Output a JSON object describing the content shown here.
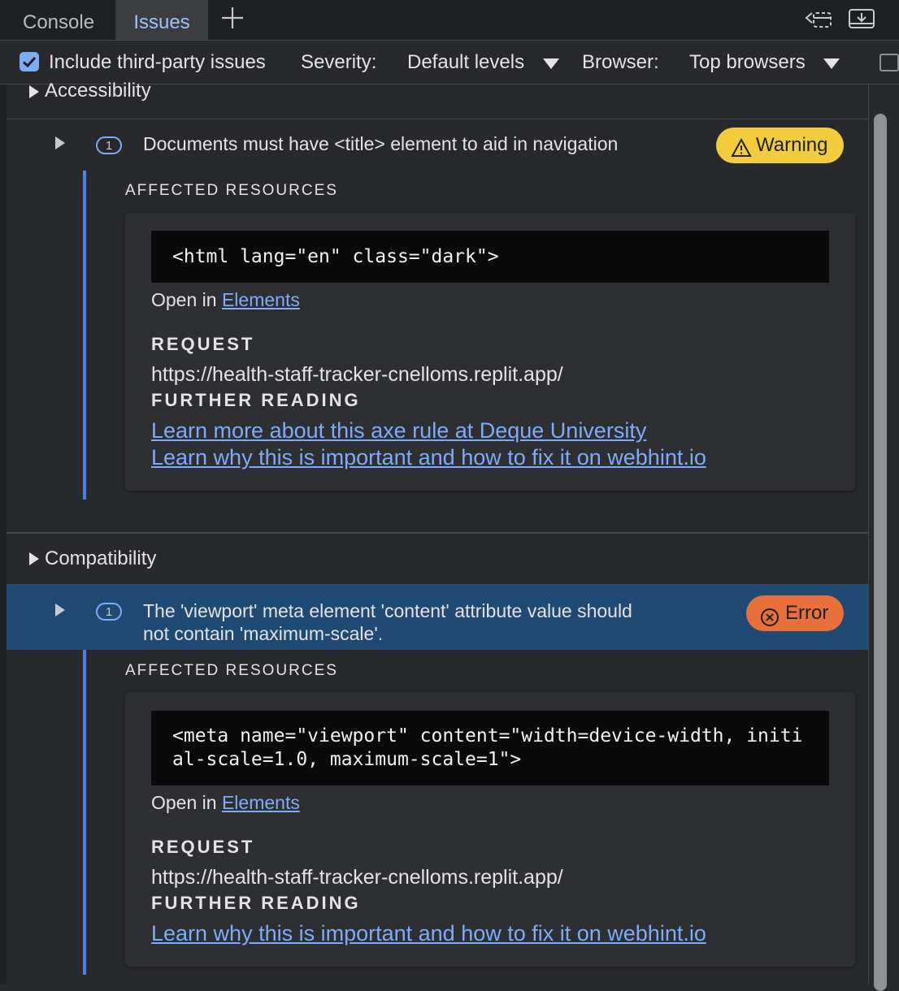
{
  "tabs": [
    {
      "label": "Console",
      "active": false
    },
    {
      "label": "Issues",
      "active": true
    }
  ],
  "toolbar": {
    "include_third_party_label": "Include third-party issues",
    "include_third_party_checked": true,
    "severity_label": "Severity:",
    "severity_value": "Default levels",
    "browser_label": "Browser:",
    "browser_value": "Top browsers"
  },
  "categories": [
    {
      "label": "Accessibility",
      "issue": {
        "count": "1",
        "title": "Documents must have <title> element to aid in navigation",
        "severity": "Warning",
        "affected_resources_label": "AFFECTED RESOURCES",
        "code": "<html lang=\"en\" class=\"dark\">",
        "open_in_prefix": "Open in",
        "open_in_link": "Elements",
        "request_label": "REQUEST",
        "request_url": "https://health-staff-tracker-cnelloms.replit.app/",
        "further_reading_label": "FURTHER READING",
        "links": [
          "Learn more about this axe rule at Deque University",
          "Learn why this is important and how to fix it on webhint.io"
        ]
      }
    },
    {
      "label": "Compatibility",
      "issue": {
        "count": "1",
        "title_line1": "The 'viewport' meta element 'content' attribute value should",
        "title_line2": "not contain 'maximum-scale'.",
        "severity": "Error",
        "affected_resources_label": "AFFECTED RESOURCES",
        "code": "<meta name=\"viewport\" content=\"width=device-width, initial-scale=1.0, maximum-scale=1\">",
        "open_in_prefix": "Open in",
        "open_in_link": "Elements",
        "request_label": "REQUEST",
        "request_url": "https://health-staff-tracker-cnelloms.replit.app/",
        "further_reading_label": "FURTHER READING",
        "links": [
          "Learn why this is important and how to fix it on webhint.io"
        ]
      }
    }
  ],
  "colors": {
    "accent": "#7cacf8",
    "warning": "#f2cc3d",
    "error": "#e8703a",
    "selected_row": "#1e4a73",
    "resource_bar": "#4a7fe3"
  },
  "icons": [
    "plus-icon",
    "dock-side-icon",
    "download-icon",
    "warning-icon",
    "error-icon",
    "caret-down-icon",
    "expand-triangle-icon"
  ]
}
